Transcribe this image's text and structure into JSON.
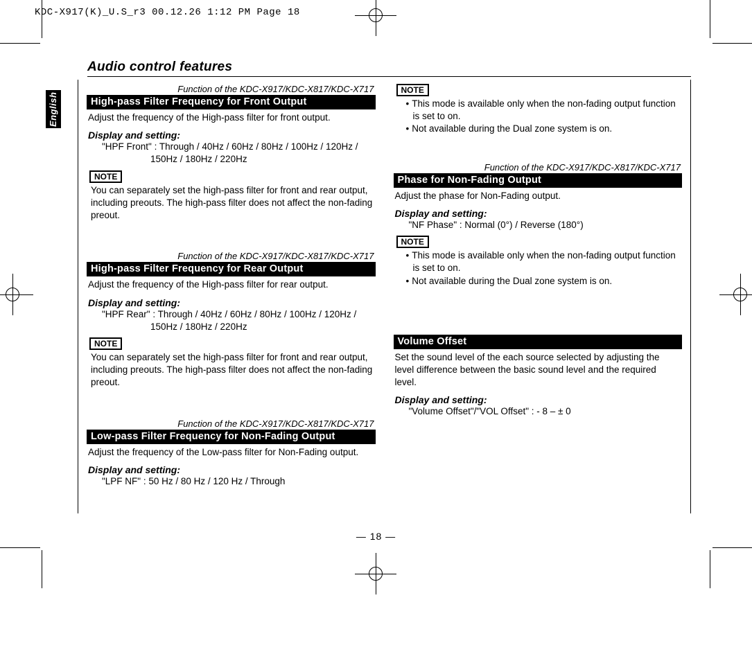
{
  "slug": "KDC-X917(K)_U.S_r3  00.12.26 1:12 PM  Page 18",
  "language_tab": "English",
  "section_title": "Audio control features",
  "page_num": "— 18 —",
  "labels": {
    "function_of": "Function of the KDC-X917/KDC-X817/KDC-X717",
    "display_and_setting": "Display and setting:",
    "note": "NOTE"
  },
  "left": {
    "s1": {
      "head": "High-pass Filter Frequency for Front Output",
      "desc": "Adjust the frequency of the High-pass filter for front output.",
      "ds1": "\"HPF Front\" : Through / 40Hz / 60Hz / 80Hz / 100Hz / 120Hz /",
      "ds2": "150Hz / 180Hz / 220Hz",
      "note": "You can separately set the high-pass filter for front and rear output, including preouts. The high-pass filter does not affect the non-fading preout."
    },
    "s2": {
      "head": "High-pass Filter Frequency for Rear Output",
      "desc": "Adjust the frequency of the High-pass filter for rear output.",
      "ds1": "\"HPF Rear\" : Through / 40Hz / 60Hz / 80Hz / 100Hz / 120Hz /",
      "ds2": "150Hz / 180Hz / 220Hz",
      "note": "You can separately set the high-pass filter for front and rear output, including preouts. The high-pass filter does not affect the non-fading preout."
    },
    "s3": {
      "head": "Low-pass Filter Frequency for Non-Fading Output",
      "desc": "Adjust the frequency of the Low-pass filter for Non-Fading output.",
      "ds1": "\"LPF NF\" : 50 Hz / 80 Hz / 120 Hz / Through"
    }
  },
  "right": {
    "pre_note_b1": "This mode is available only when the non-fading output function is set to on.",
    "pre_note_b2": "Not available during the Dual zone system is on.",
    "s1": {
      "head": "Phase for Non-Fading Output",
      "desc": "Adjust the phase for Non-Fading output.",
      "ds1": "\"NF Phase\" : Normal (0°) / Reverse (180°)",
      "b1": "This mode is available only when the non-fading output function is set to on.",
      "b2": "Not available during the Dual zone system is on."
    },
    "s2": {
      "head": "Volume Offset",
      "desc": "Set the sound level of the each source selected by adjusting the level difference between the basic sound level and the required level.",
      "ds1": "\"Volume Offset\"/\"VOL Offset\" : - 8  –  ± 0"
    }
  }
}
